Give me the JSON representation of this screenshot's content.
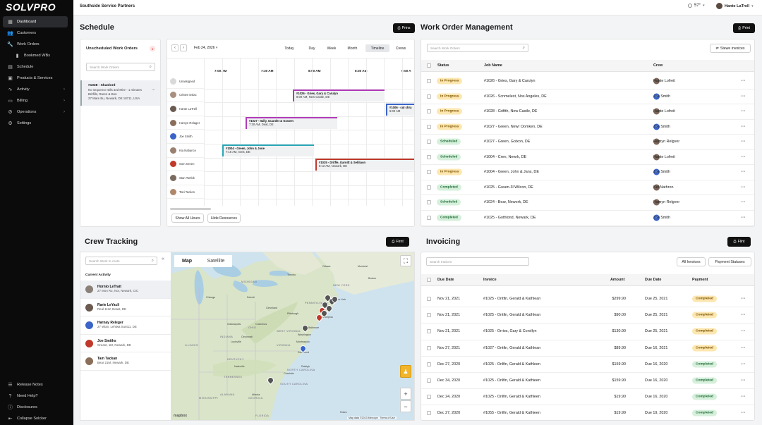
{
  "app": {
    "logo": "SOLVPRO",
    "company": "Southside Service Partners",
    "weather": "57°",
    "user": "Hante LaTrell"
  },
  "sidebar": {
    "items": [
      {
        "label": "Dashboard",
        "icon": "grid-icon",
        "active": true
      },
      {
        "label": "Customers",
        "icon": "people-icon"
      },
      {
        "label": "Work Orders",
        "icon": "wrench-icon"
      },
      {
        "label": "Bookmed WBs",
        "icon": "bookmark-icon",
        "sub": true
      },
      {
        "label": "Schedule",
        "icon": "calendar-icon"
      },
      {
        "label": "Products & Services",
        "icon": "box-icon"
      },
      {
        "label": "Activity",
        "icon": "pulse-icon",
        "chevron": true
      },
      {
        "label": "Billing",
        "icon": "card-icon",
        "chevron": true
      },
      {
        "label": "Operations",
        "icon": "gear-icon",
        "chevron": true
      },
      {
        "label": "Settings",
        "icon": "settings-icon"
      }
    ],
    "bottom": [
      {
        "label": "Release Notes",
        "icon": "notes-icon"
      },
      {
        "label": "Need Help?",
        "icon": "help-icon"
      },
      {
        "label": "Disclosures",
        "icon": "info-icon"
      },
      {
        "label": "Collapse Solcker",
        "icon": "collapse-icon"
      }
    ]
  },
  "schedule": {
    "title": "Schedule",
    "print": "Prins",
    "unscheduled": {
      "title": "Unscheduled Work Orders",
      "count": "1",
      "search_placeholder": "Search Work Orders",
      "item": {
        "title": "#1028 - Shanlord",
        "line1": "No sequence stlls and Mire - 1 minutes",
        "line2": "Britfills, Raren & Bon",
        "line3": "27 Mare Bu, Newark, DE 18711, USA"
      }
    },
    "calendar": {
      "date": "Feb 24, 2026",
      "views": [
        "Today",
        "Day",
        "Week",
        "Month",
        "Timeline",
        "Crews"
      ],
      "active_view": "Timeline",
      "times": [
        "7:00 AM",
        "7:30 AM",
        "8:00 AM",
        "8:30 AM",
        "9:00 A"
      ],
      "resources": [
        "Unassigned",
        "Cristen Eslac",
        "Hante LaTrell",
        "Hamyn Relager",
        "Joe Smith",
        "Kia Nabance",
        "Som Green",
        "Stan Tortlck",
        "Toni Tacken"
      ],
      "events": [
        {
          "title": "#1026 - Gries, Gary & Carulyn",
          "sub": "8:00 AM, New Castle, DE"
        },
        {
          "title": "#1006 - cul chra",
          "sub": "5:00 AM"
        },
        {
          "title": "#1027 - Itally, Guardst & Granen",
          "sub": "7:30 AM, Deat, DE"
        },
        {
          "title": "#1004 - Green, John & Jone",
          "sub": "7:15 AM, Gest, DE"
        },
        {
          "title": "#1025 - Dritfle, Garnitt & Seliliaon",
          "sub": "8:12 AM, Newark, DE"
        }
      ],
      "show_all_hours": "Show All Hours",
      "hide_resources": "Hide Resources"
    }
  },
  "work_orders": {
    "title": "Work Order Management",
    "print": "Print",
    "search_placeholder": "Search Work Orders",
    "stewe_invoices": "Stewe invoices",
    "headers": [
      "Status",
      "Job Name",
      "Crew"
    ],
    "rows": [
      {
        "status": "In Progress",
        "job": "#1026 - Gries, Gary & Carulyn",
        "crew": "Hante Lofreit",
        "av": "photo"
      },
      {
        "status": "In Progress",
        "job": "#1026 - Scnmelest, Nos Angeles, DE",
        "crew": "Joe Smith",
        "av": "JS"
      },
      {
        "status": "In Progress",
        "job": "#1028 - Griftth, New Castle, DE",
        "crew": "Hante Lofreit",
        "av": "photo"
      },
      {
        "status": "In Progress",
        "job": "#1027 - Green, Newr Oomken, DE",
        "crew": "Joe Smith",
        "av": "JS"
      },
      {
        "status": "Scheduled",
        "job": "#1027 - Green, Golxon, DE",
        "crew": "Hamyn Relgver",
        "av": "photo"
      },
      {
        "status": "Scheduled",
        "job": "#1004 - Cren, Newrk, DE",
        "crew": "Hante Lofreit",
        "av": "photo"
      },
      {
        "status": "In Progress",
        "job": "#1004 - Green, John & Jans, DE",
        "crew": "Joe Smith",
        "av": "JS"
      },
      {
        "status": "Completed",
        "job": "#1025 - Gusen-3l Wilcon, DE",
        "crew": "Kel Nathron",
        "av": "photo"
      },
      {
        "status": "Scheduled",
        "job": "#1024 - Bear, Nework, DE",
        "crew": "Hamyn Relgver",
        "av": "photo"
      },
      {
        "status": "Completed",
        "job": "#1025 - Gothlond, Newark, DE",
        "crew": "Joe Smith",
        "av": "JS"
      }
    ]
  },
  "crew_tracking": {
    "title": "Crew Tracking",
    "print": "Firnt",
    "search_placeholder": "Search Work to cacts",
    "current_activity": "Current Activity",
    "items": [
      {
        "name": "Hornio LeTrait",
        "addr": "27 Mon Ru, Nor, Newark, CIC"
      },
      {
        "name": "Rarie LeYacli",
        "addr": "Real 11W, Boast, DE"
      },
      {
        "name": "Harnay Releger",
        "addr": "27 Wian, Lehlwa Sunt11, DE"
      },
      {
        "name": "Joe Smiths",
        "addr": "Greant, 1M, Newark, DE"
      },
      {
        "name": "Tam Tackan",
        "addr": "Bear 21M, Newark, DE"
      }
    ],
    "map": {
      "tab_map": "Map",
      "tab_sat": "Satellite",
      "labels": [
        "ILLINOIS",
        "Chicago",
        "INDIANA",
        "OHIO",
        "KENTUCKY",
        "TENNESSEE",
        "GEORGIA",
        "ALABAMA",
        "MISSISSIPPI",
        "FLORIDA",
        "SOUTH CAROLINA",
        "NORTH CAROLINA",
        "VIRGINIA",
        "WEST VIRGINIA",
        "PENNSYLVANIA",
        "NEW YORK",
        "MICHIGAN",
        "Cleveland",
        "Pittsburgh",
        "Washington",
        "Baltimore",
        "Philadelphia",
        "New York",
        "Boston",
        "Toronto",
        "Ottawa",
        "Montréal",
        "Detroit",
        "Atlanta",
        "Charlotte",
        "Raleigh",
        "Nashville",
        "Louisville",
        "Indianapolis",
        "Columbus",
        "Cincinnati",
        "Richmond",
        "Monteapolo",
        "Rdam"
      ],
      "attribution": "Map data ©2013 Mercope",
      "terms": "Terms of Use",
      "logo": "mapbox"
    }
  },
  "invoicing": {
    "title": "Invoicing",
    "print": "Flint",
    "search_placeholder": "Search Inwices",
    "all_invoices": "All Invoices",
    "payment_statuses": "Payment Statuses",
    "headers": [
      "Due Date",
      "Invoice",
      "Amount",
      "Due Date",
      "Payment"
    ],
    "rows": [
      {
        "date": "Nov 21, 2021",
        "inv": "#1025 - Ontfin, Gerald & Kathlean",
        "amt": "$299.90",
        "due": "Due 25, 2021",
        "pay": "Completed",
        "y": true
      },
      {
        "date": "Nov 21, 2021",
        "inv": "#1025 - Ontfin, Gerald & Kathlean",
        "amt": "$90.00",
        "due": "Due 25, 2021",
        "pay": "Completed",
        "y": true
      },
      {
        "date": "Nov 21, 2021",
        "inv": "#1025 - Orrios, Gary & Corollyn",
        "amt": "$130.90",
        "due": "Due 25, 2021",
        "pay": "Completed",
        "y": true
      },
      {
        "date": "Nov 27, 2021",
        "inv": "#1027 - Ontfin, Gerald & Kathlean",
        "amt": "$89.90",
        "due": "Due 16, 2021",
        "pay": "Completed",
        "y": true
      },
      {
        "date": "Dec 27, 2020",
        "inv": "#1025 - Onlfin, Gerald & Kathleen",
        "amt": "$159.90",
        "due": "Due 16, 2020",
        "pay": "Completed",
        "y": false
      },
      {
        "date": "Dec 34, 2020",
        "inv": "#1025 - Onlfin, Gerald & Kathieen",
        "amt": "$159.90",
        "due": "Due 16, 2020",
        "pay": "Completed",
        "y": false
      },
      {
        "date": "Dec 24, 2020",
        "inv": "#1025 - Onlfin, Gerald & Kathleen",
        "amt": "$19.90",
        "due": "Due 16, 2020",
        "pay": "Completed",
        "y": false
      },
      {
        "date": "Dec 27, 2020",
        "inv": "#1055 - Onlfin, Gerald & Kathieen",
        "amt": "$19.99",
        "due": "Due 19, 2020",
        "pay": "Completed",
        "y": false
      }
    ]
  },
  "colors": {
    "accent_purple": "#b03ab8",
    "accent_blue": "#3a64c8",
    "accent_teal": "#2aa7b8",
    "accent_red": "#c0392b"
  }
}
